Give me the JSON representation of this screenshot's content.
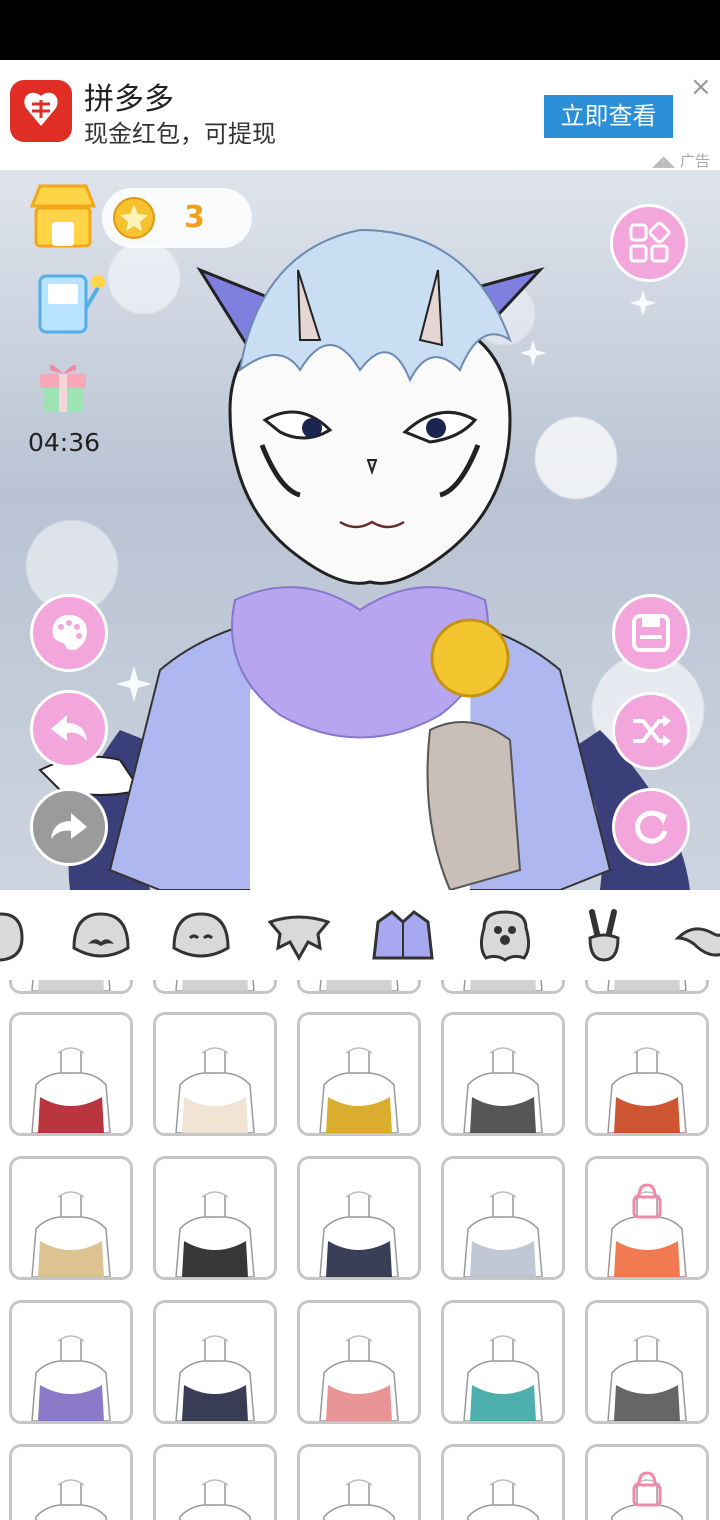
{
  "ad": {
    "app_name": "拼多多",
    "subtitle": "现金红包，可提现",
    "button_label": "立即查看",
    "close_symbol": "×",
    "ad_label": "广告",
    "brand_color": "#e02e24",
    "button_color": "#2a8fd6"
  },
  "hud": {
    "coin_count": "3",
    "timer": "04:36"
  },
  "left_buttons": [
    {
      "name": "palette-button",
      "icon": "palette-icon"
    },
    {
      "name": "undo-button",
      "icon": "undo-arrow-icon"
    },
    {
      "name": "redo-button",
      "icon": "redo-arrow-icon",
      "disabled": true
    }
  ],
  "right_buttons": [
    {
      "name": "gallery-button",
      "icon": "grid-icon"
    },
    {
      "name": "save-button",
      "icon": "save-icon"
    },
    {
      "name": "shuffle-button",
      "icon": "shuffle-icon"
    },
    {
      "name": "reset-button",
      "icon": "refresh-icon"
    }
  ],
  "categories": [
    {
      "name": "head-icon"
    },
    {
      "name": "mustache-face-icon"
    },
    {
      "name": "face-icon"
    },
    {
      "name": "wings-icon"
    },
    {
      "name": "shirt-icon",
      "selected": true
    },
    {
      "name": "paw-icon"
    },
    {
      "name": "peace-hand-icon"
    },
    {
      "name": "tail-icon"
    }
  ],
  "items": [
    {
      "name": "red-scarf",
      "color": "#b3202a"
    },
    {
      "name": "fur-collar",
      "color": "#efe1cf"
    },
    {
      "name": "gold-collar",
      "color": "#d7a417"
    },
    {
      "name": "pendant-necklace",
      "color": "#444444"
    },
    {
      "name": "red-halter",
      "color": "#c8421c"
    },
    {
      "name": "tan-vest",
      "color": "#d9bd86"
    },
    {
      "name": "black-tuxedo-vest",
      "color": "#222222"
    },
    {
      "name": "navy-camisole",
      "color": "#242a44"
    },
    {
      "name": "gray-hoodie-top",
      "color": "#b9c2d1"
    },
    {
      "name": "locked-scratch",
      "color": "#f06b3e",
      "locked": true
    },
    {
      "name": "purple-crop-top",
      "color": "#7d6cc1"
    },
    {
      "name": "navy-bandage-vest",
      "color": "#232743"
    },
    {
      "name": "pink-x-mark",
      "color": "#e88a8a"
    },
    {
      "name": "teal-sash",
      "color": "#3aa7a3"
    },
    {
      "name": "claw-scratch",
      "color": "#555555"
    },
    {
      "name": "red-top",
      "color": "#b6361f"
    },
    {
      "name": "dark-top",
      "color": "#2a2230"
    },
    {
      "name": "navy-strap",
      "color": "#2b3a6b"
    },
    {
      "name": "plain-skin",
      "color": "#cccccc"
    },
    {
      "name": "locked-gold-top",
      "color": "#e8b43a",
      "locked": true
    }
  ]
}
